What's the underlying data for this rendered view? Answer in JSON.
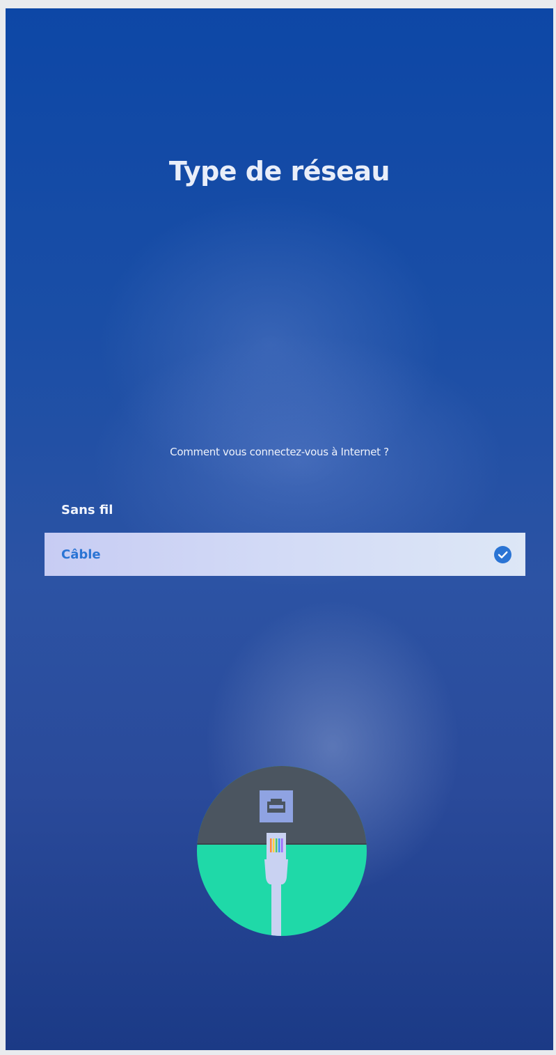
{
  "screen": {
    "title": "Type de réseau",
    "question": "Comment vous connectez-vous à Internet ?"
  },
  "options": [
    {
      "label": "Sans fil",
      "selected": false
    },
    {
      "label": "Câble",
      "selected": true
    }
  ],
  "icons": {
    "selected_check": "check-circle-icon",
    "illustration": "ethernet-cable-icon"
  },
  "colors": {
    "background": "#1b4ea6",
    "selected_row": "#d3dbf6",
    "selected_text": "#2a74d4",
    "check": "#2a74d4",
    "illustration_top": "#4b5560",
    "illustration_bottom": "#1fd9a8"
  }
}
